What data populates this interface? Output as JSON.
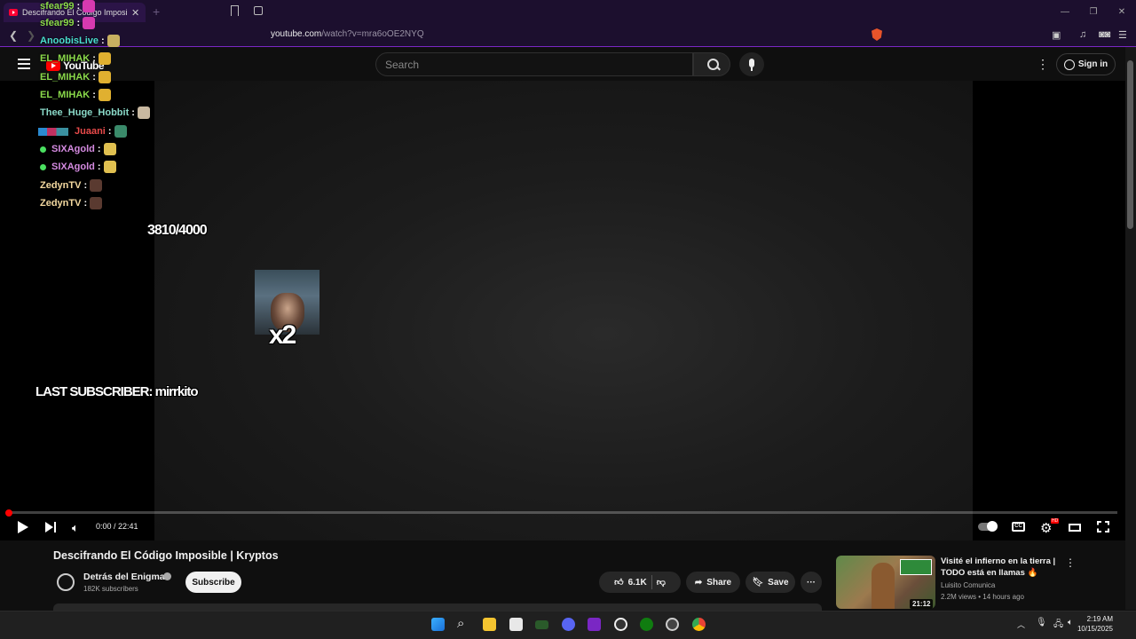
{
  "browser": {
    "tab_title": "Descifrando El Código Imposible",
    "url_host": "youtube.com",
    "url_path": "/watch?v=mra6oOE2NYQ"
  },
  "header": {
    "logo_text": "YouTube",
    "search_placeholder": "Search",
    "signin_label": "Sign in"
  },
  "chat": [
    {
      "user": "sfear99",
      "color": "#8ad94a"
    },
    {
      "user": "sfear99",
      "color": "#8ad94a"
    },
    {
      "user": "AnoobisLive",
      "color": "#4adfd0"
    },
    {
      "user": "EL_MIHAK",
      "color": "#8ad94a"
    },
    {
      "user": "EL_MIHAK",
      "color": "#8ad94a"
    },
    {
      "user": "EL_MIHAK",
      "color": "#8ad94a"
    },
    {
      "user": "Thee_Huge_Hobbit",
      "color": "#8ad9c8"
    },
    {
      "user": "Juaani",
      "color": "#e84a4a"
    },
    {
      "user": "SIXAgold",
      "color": "#d48ae0"
    },
    {
      "user": "SIXAgold",
      "color": "#d48ae0"
    },
    {
      "user": "ZedynTV",
      "color": "#f4d9a0"
    },
    {
      "user": "ZedynTV",
      "color": "#f4d9a0"
    }
  ],
  "chat_separator": ":",
  "overlay": {
    "goal": "3810/4000",
    "multiplier": "x2",
    "last_subscriber": "LAST SUBSCRIBER: mirrkito"
  },
  "player": {
    "time": "0:00 / 22:41",
    "progress": 0.0,
    "hd_badge": "HD"
  },
  "video": {
    "title": "Descifrando El Código Imposible | Kryptos",
    "channel": "Detrás del Enigma",
    "subscribers": "182K subscribers",
    "subscribe_label": "Subscribe",
    "likes": "6.1K",
    "share_label": "Share",
    "save_label": "Save"
  },
  "recommended": {
    "title": "Visité el infierno en la tierra | TODO está en llamas 🔥",
    "channel": "Luisito Comunica",
    "meta": "2.2M views • 14 hours ago",
    "duration": "21:12"
  },
  "taskbar": {
    "time": "2:19 AM",
    "date": "10/15/2025"
  },
  "colors": {
    "browser_bg": "#1c0f2e",
    "accent": "#7a27c4",
    "yt_red": "#ff0000"
  }
}
